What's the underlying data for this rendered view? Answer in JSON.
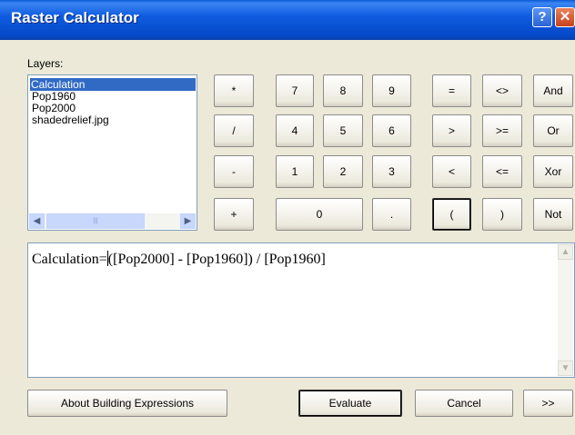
{
  "window": {
    "title": "Raster Calculator",
    "help_glyph": "?",
    "close_glyph": "✕"
  },
  "layers": {
    "label": "Layers:",
    "items": [
      "Calculation",
      "Pop1960",
      "Pop2000",
      "shadedrelief.jpg"
    ],
    "selected_index": 0,
    "scroll_left": "◀",
    "scroll_right": "▶",
    "scroll_grip": "|||"
  },
  "keypad": {
    "multiply": "*",
    "divide": "/",
    "minus": "-",
    "plus": "+",
    "d7": "7",
    "d8": "8",
    "d9": "9",
    "d4": "4",
    "d5": "5",
    "d6": "6",
    "d1": "1",
    "d2": "2",
    "d3": "3",
    "d0": "0",
    "dot": ".",
    "eq": "=",
    "ne": "<>",
    "and": "And",
    "gt": ">",
    "ge": ">=",
    "or": "Or",
    "lt": "<",
    "le": "<=",
    "xor": "Xor",
    "lparen": "(",
    "rparen": ")",
    "not": "Not"
  },
  "expression": {
    "before_caret": "Calculation=",
    "after_caret": "([Pop2000] - [Pop1960]) / [Pop1960]",
    "scroll_up": "▲",
    "scroll_down": "▼"
  },
  "footer": {
    "about": "About Building Expressions",
    "evaluate": "Evaluate",
    "cancel": "Cancel",
    "more": ">>"
  }
}
